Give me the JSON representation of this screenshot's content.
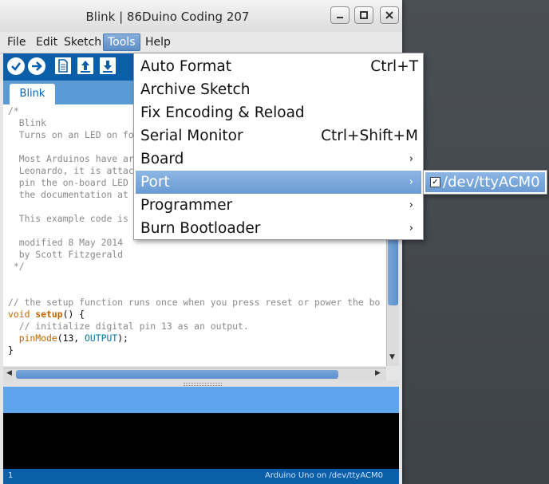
{
  "window": {
    "title": "Blink | 86Duino Coding 207"
  },
  "menubar": {
    "items": [
      "File",
      "Edit",
      "Sketch",
      "Tools",
      "Help"
    ],
    "active": "Tools"
  },
  "tabs": [
    {
      "label": "Blink"
    }
  ],
  "code_lines": [
    "/*",
    "  Blink",
    "  Turns on an LED on fo",
    "",
    "  Most Arduinos have ar",
    "  Leonardo, it is attac",
    "  pin the on-board LED",
    "  the documentation at",
    "",
    "  This example code is",
    "",
    "  modified 8 May 2014",
    "  by Scott Fitzgerald",
    " */",
    "",
    "",
    "// the setup function runs once when you press reset or power the bo",
    "void setup() {",
    "  // initialize digital pin 13 as an output.",
    "  pinMode(13, OUTPUT);",
    "}"
  ],
  "tools_menu": {
    "items": [
      {
        "label": "Auto Format",
        "shortcut": "Ctrl+T"
      },
      {
        "label": "Archive Sketch",
        "shortcut": ""
      },
      {
        "label": "Fix Encoding & Reload",
        "shortcut": ""
      },
      {
        "label": "Serial Monitor",
        "shortcut": "Ctrl+Shift+M"
      },
      {
        "label": "Board",
        "submenu": true
      },
      {
        "label": "Port",
        "submenu": true,
        "highlighted": true
      },
      {
        "label": "Programmer",
        "submenu": true
      },
      {
        "label": "Burn Bootloader",
        "submenu": true
      }
    ]
  },
  "port_submenu": {
    "items": [
      {
        "label": "/dev/ttyACM0",
        "checked": true
      }
    ]
  },
  "status": {
    "line": "1",
    "board": "Arduino Uno on /dev/ttyACM0"
  },
  "colors": {
    "toolbar": "#0b5ea8",
    "tabstrip": "#5b9bd5",
    "highlight": "#6a9bd3",
    "console": "#000000"
  }
}
